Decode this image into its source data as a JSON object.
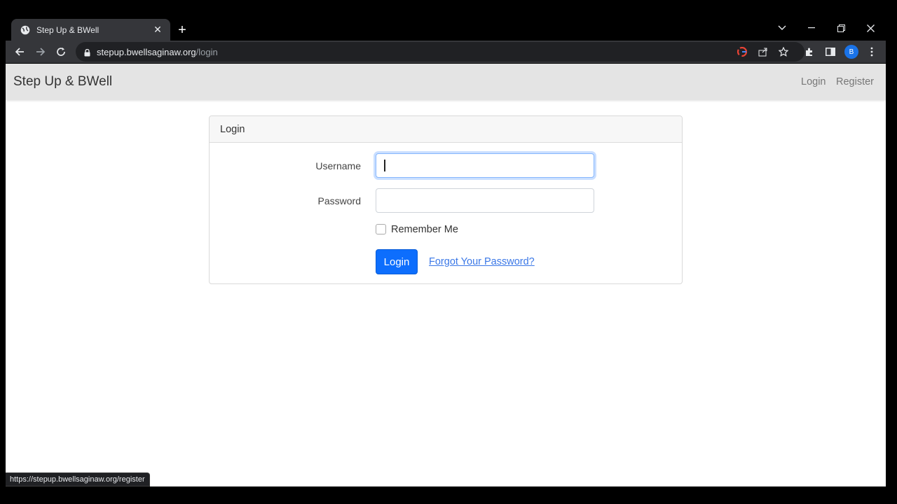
{
  "browser": {
    "tab_title": "Step Up & BWell",
    "url_host": "stepup.bwellsaginaw.org",
    "url_path": "/login",
    "profile_initial": "B",
    "status_url": "https://stepup.bwellsaginaw.org/register",
    "accent": "#1a73e8"
  },
  "site": {
    "brand": "Step Up & BWell",
    "nav": {
      "login": "Login",
      "register": "Register"
    }
  },
  "login_card": {
    "header": "Login",
    "username_label": "Username",
    "username_value": "",
    "password_label": "Password",
    "password_value": "",
    "remember_label": "Remember Me",
    "remember_checked": false,
    "submit_label": "Login",
    "forgot_link": "Forgot Your Password?",
    "button_color": "#0d6efd"
  }
}
